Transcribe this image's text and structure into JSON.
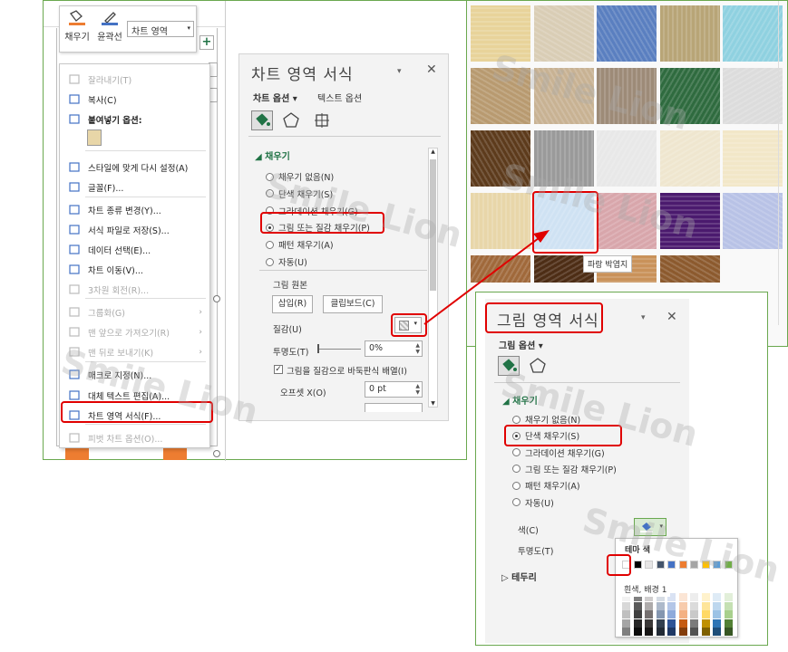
{
  "mini_toolbar": {
    "fill_label": "채우기",
    "outline_label": "윤곽선",
    "combo_value": "차트 영역"
  },
  "context_menu": {
    "items": [
      {
        "label": "잘라내기(T)",
        "disabled": true
      },
      {
        "label": "복사(C)",
        "disabled": false
      },
      {
        "label": "붙여넣기 옵션:",
        "disabled": false,
        "bold": true
      },
      {
        "label": "스타일에 맞게 다시 설정(A)",
        "disabled": false
      },
      {
        "label": "글꼴(F)...",
        "disabled": false
      },
      {
        "label": "차트 종류 변경(Y)...",
        "disabled": false
      },
      {
        "label": "서식 파일로 저장(S)...",
        "disabled": false
      },
      {
        "label": "데이터 선택(E)...",
        "disabled": false
      },
      {
        "label": "차트 이동(V)...",
        "disabled": false
      },
      {
        "label": "3차원 회전(R)...",
        "disabled": true
      },
      {
        "label": "그룹화(G)",
        "disabled": true
      },
      {
        "label": "맨 앞으로 가져오기(R)",
        "disabled": true
      },
      {
        "label": "맨 뒤로 보내기(K)",
        "disabled": true
      },
      {
        "label": "매크로 지정(N)...",
        "disabled": false
      },
      {
        "label": "대체 텍스트 편집(A)...",
        "disabled": false
      },
      {
        "label": "차트 영역 서식(F)...",
        "disabled": false
      },
      {
        "label": "피벗 차트 옵션(O)...",
        "disabled": true
      }
    ]
  },
  "pane1": {
    "title": "차트 영역 서식",
    "tab_chart": "차트 옵션",
    "tab_text": "텍스트 옵션",
    "section_fill": "채우기",
    "radios": [
      "채우기 없음(N)",
      "단색 채우기(S)",
      "그라데이션 채우기(G)",
      "그림 또는 질감 채우기(P)",
      "패턴 채우기(A)",
      "자동(U)"
    ],
    "selected_radio": 3,
    "picture_source": "그림 원본",
    "insert_btn": "삽입(R)",
    "clipboard_btn": "클립보드(C)",
    "texture_label": "질감(U)",
    "transparency_label": "투명도(T)",
    "transparency_value": "0%",
    "tile_label": "그림을 질감으로 바둑판식 배열(I)",
    "offset_x_label": "오프셋 X(O)",
    "offset_x_value": "0 pt"
  },
  "texture_tooltip": "파랑 박엽지",
  "pane2": {
    "title": "그림 영역 서식",
    "tab_chart": "그림 옵션",
    "section_fill": "채우기",
    "radios": [
      "채우기 없음(N)",
      "단색 채우기(S)",
      "그라데이션 채우기(G)",
      "그림 또는 질감 채우기(P)",
      "패턴 채우기(A)",
      "자동(U)"
    ],
    "selected_radio": 1,
    "color_label": "색(C)",
    "transparency_label": "투명도(T)",
    "border_label": "테두리",
    "theme_colors_label": "테마 색",
    "swatch_tooltip": "흰색, 배경 1"
  },
  "watermark": "Smile Lion",
  "colors": {
    "accent_red": "#e00000",
    "excel_green": "#217346",
    "orange": "#ed7d31",
    "frame_green": "#6aa84f"
  }
}
